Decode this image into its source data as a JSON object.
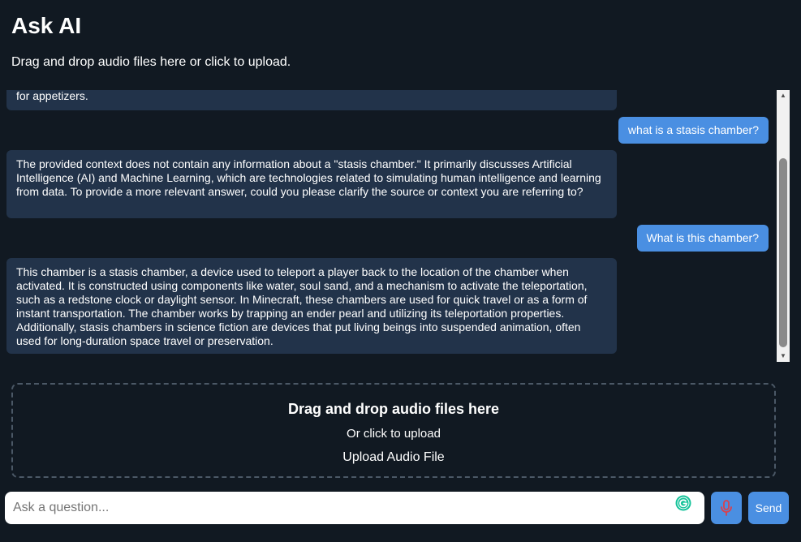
{
  "header": {
    "title": "Ask AI",
    "subtitle": "Drag and drop audio files here or click to upload."
  },
  "chat": {
    "messages": [
      {
        "role": "ai",
        "text": "for appetizers."
      },
      {
        "role": "user",
        "text": "what is a stasis chamber?"
      },
      {
        "role": "ai",
        "text": "The provided context does not contain any information about a \"stasis chamber.\" It primarily discusses Artificial Intelligence (AI) and Machine Learning, which are technologies related to simulating human intelligence and learning from data. To provide a more relevant answer, could you please clarify the source or context you are referring to?"
      },
      {
        "role": "user",
        "text": "What is this chamber?"
      },
      {
        "role": "ai",
        "text": "This chamber is a stasis chamber, a device used to teleport a player back to the location of the chamber when activated. It is constructed using components like water, soul sand, and a mechanism to activate the teleportation, such as a redstone clock or daylight sensor. In Minecraft, these chambers are used for quick travel or as a form of instant transportation. The chamber works by trapping an ender pearl and utilizing its teleportation properties. Additionally, stasis chambers in science fiction are devices that put living beings into suspended animation, often used for long-duration space travel or preservation."
      }
    ]
  },
  "dropzone": {
    "title": "Drag and drop audio files here",
    "subtitle": "Or click to upload",
    "upload_label": "Upload Audio File"
  },
  "input": {
    "placeholder": "Ask a question...",
    "value": ""
  },
  "buttons": {
    "mic_icon": "microphone-icon",
    "send_label": "Send"
  },
  "colors": {
    "background": "#111922",
    "ai_bubble": "#22334a",
    "user_bubble": "#4a8fe2",
    "button": "#4a8fe2",
    "mic_glyph": "#d9414d"
  }
}
